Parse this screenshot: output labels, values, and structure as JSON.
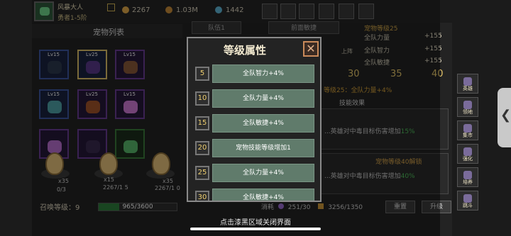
{
  "player": {
    "name": "风暴大人",
    "rank": "勇者1-5阶",
    "gold": "2267",
    "coins": "1.03M",
    "gems": "1442"
  },
  "pet_list": {
    "title": "宠物列表",
    "levels": [
      "Lv15",
      "Lv25",
      "Lv15",
      "Lv15",
      "Lv25",
      "Lv15"
    ]
  },
  "eggs": [
    {
      "count": "x35",
      "progress": "0/3"
    },
    {
      "count": "x15",
      "progress": "2267/1 5"
    },
    {
      "count": "x35",
      "progress": "2267/1 0"
    }
  ],
  "summon": {
    "label": "召唤等级：",
    "level": "9",
    "progress_text": "965/3600",
    "progress_fraction": 0.268
  },
  "tabs": {
    "team": "队伍1",
    "rotate": "前面敏捷"
  },
  "grade_panel": {
    "title": "宠物等级25",
    "upper_label": "上阵",
    "stats": [
      {
        "label": "全队力量",
        "value": "+155"
      },
      {
        "label": "全队智力",
        "value": "+155"
      },
      {
        "label": "全队敏捷",
        "value": "+155"
      }
    ],
    "levels": [
      "30",
      "35",
      "40"
    ],
    "grade_line": "等级25：全队力量+4%"
  },
  "skill": {
    "title": "技能效果",
    "text1": "...英雄对中毒目标伤害增加",
    "pct1": "15%",
    "unlock": "宠物等级40解锁",
    "text2": "...英雄对中毒目标伤害增加",
    "pct2": "40%"
  },
  "bottom": {
    "cost_label": "消耗",
    "cost": "251/30",
    "coins": "3256/1350",
    "reset": "重置",
    "upgrade": "升级"
  },
  "sidebar": [
    "英雄",
    "领地",
    "集市",
    "强化",
    "培养",
    "跳斗"
  ],
  "modal": {
    "title": "等级属性",
    "rows": [
      {
        "level": "5",
        "text": "全队智力+4%"
      },
      {
        "level": "10",
        "text": "全队力量+4%"
      },
      {
        "level": "15",
        "text": "全队敏捷+4%"
      },
      {
        "level": "20",
        "text": "宠物技能等级增加1"
      },
      {
        "level": "25",
        "text": "全队力量+4%"
      },
      {
        "level": "30",
        "text": "全队敏捷+4%"
      }
    ]
  },
  "hint": "点击漆黑区域关闭界面",
  "colors": {
    "accent": "#e0c46a",
    "row_bg": "#607b6b",
    "progress": "#2f7e3c"
  }
}
